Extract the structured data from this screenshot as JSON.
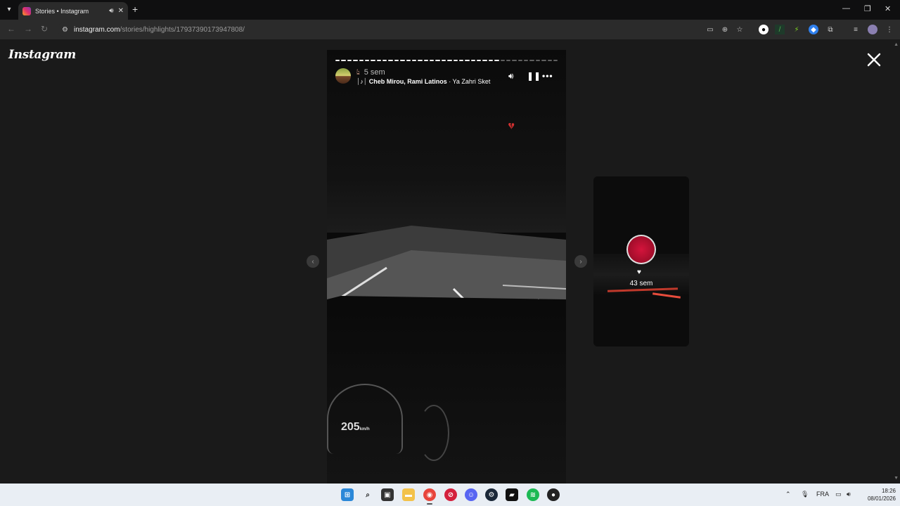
{
  "browser": {
    "tab_title": "Stories • Instagram",
    "url_host": "instagram.com",
    "url_path": "/stories/highlights/17937390173947808/"
  },
  "page": {
    "brand": "Instagram"
  },
  "story": {
    "progress_total_segments": 38,
    "progress_completed_segments": 28,
    "time_ago": "5 sem",
    "music_artists": "Cheb Mirou, Rami Latinos",
    "music_song": " · Ya Zahri Sket",
    "speed_readout": "205",
    "speed_unit": "km/h"
  },
  "next_preview": {
    "time_ago": "43 sem"
  },
  "taskbar": {
    "language": "FRA",
    "time": "18:26",
    "date": "08/01/2026"
  },
  "icons": {
    "mute": "speaker-icon",
    "pause": "pause-icon",
    "more": "ellipsis-icon",
    "close": "close-icon"
  }
}
